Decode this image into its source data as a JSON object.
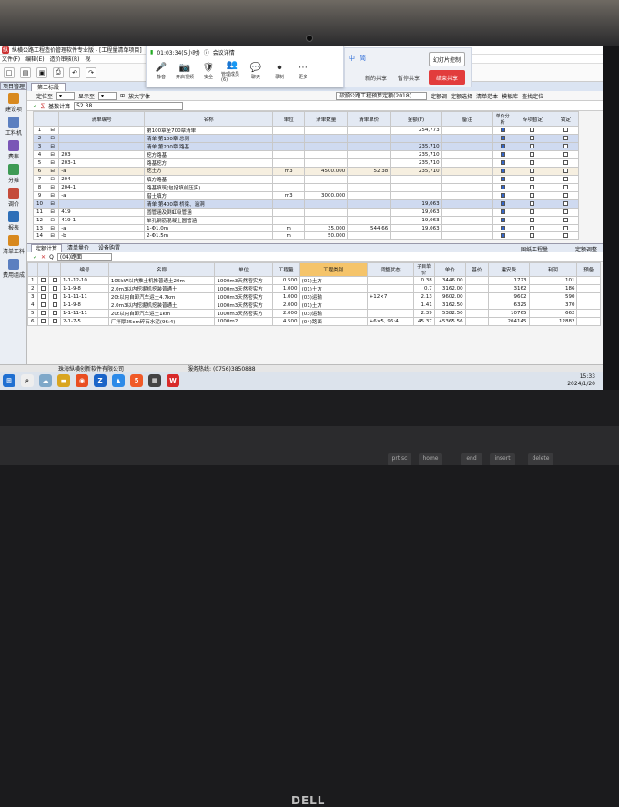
{
  "window": {
    "title": "纵横公路工程造价管理软件专业版 - [工程量清单项目]"
  },
  "menu": [
    "文件(F)",
    "编辑(E)",
    "造价审核(R)",
    "视"
  ],
  "meeting": {
    "timer": "01:03:34(5小时)",
    "info": "会议详情",
    "buttons": [
      "静音",
      "开启视频",
      "安全",
      "管理成员(6)",
      "聊天",
      "录制",
      "更多"
    ],
    "glyphs": [
      "🎤",
      "📷",
      "🛡",
      "👥",
      "💬",
      "⏺",
      "⋯"
    ]
  },
  "share_panel": {
    "left_label": "中",
    "lang": "简",
    "button_new": "新的共享",
    "button_pause": "暂停共享",
    "button_whiteboard": "幻灯片控制",
    "button_end": "结束共享"
  },
  "left_nav": {
    "project_tab": "项目管理",
    "items": [
      "建设项",
      "工料机",
      "费率",
      "分摊",
      "调价",
      "报表",
      "清单工料",
      "费用组成"
    ]
  },
  "tabs": {
    "second_tab": "第二标段"
  },
  "toolbar1": {
    "locate": "定位至",
    "display": "显示至",
    "zoom": "放大字体",
    "standard": "部颁公路工程预算定额(2018)",
    "actions": [
      "定额调",
      "定额选择",
      "清单范本",
      "模板库",
      "查找定位"
    ]
  },
  "toolbar2": {
    "base_calc": "基数计算",
    "value": "52.38"
  },
  "table1": {
    "headers": [
      "清单编号",
      "名称",
      "单位",
      "清单数量",
      "清单单价",
      "金额(F)",
      "备注",
      "单价分析",
      "专项暂定",
      "锁定"
    ],
    "rows": [
      {
        "n": "1",
        "code": "",
        "name": "第100章至700章清单",
        "unit": "",
        "qty": "",
        "price": "",
        "amount": "254,773",
        "note": "",
        "a": true,
        "b": false,
        "c": false,
        "style": ""
      },
      {
        "n": "2",
        "code": "",
        "name": "清单 第100章 总则",
        "unit": "",
        "qty": "",
        "price": "",
        "amount": "",
        "note": "",
        "a": true,
        "b": false,
        "c": false,
        "style": "blue"
      },
      {
        "n": "3",
        "code": "",
        "name": "清单 第200章 路基",
        "unit": "",
        "qty": "",
        "price": "",
        "amount": "235,710",
        "note": "",
        "a": true,
        "b": false,
        "c": false,
        "style": "blue"
      },
      {
        "n": "4",
        "code": "203",
        "name": "挖方路基",
        "unit": "",
        "qty": "",
        "price": "",
        "amount": "235,710",
        "note": "",
        "a": true,
        "b": false,
        "c": false,
        "style": ""
      },
      {
        "n": "5",
        "code": "203-1",
        "name": "路基挖方",
        "unit": "",
        "qty": "",
        "price": "",
        "amount": "235,710",
        "note": "",
        "a": true,
        "b": false,
        "c": false,
        "style": ""
      },
      {
        "n": "6",
        "code": "-a",
        "name": "挖土方",
        "unit": "m3",
        "qty": "4500.000",
        "price": "52.38",
        "amount": "235,710",
        "note": "",
        "a": true,
        "b": false,
        "c": false,
        "style": "sel"
      },
      {
        "n": "7",
        "code": "204",
        "name": "填方路基",
        "unit": "",
        "qty": "",
        "price": "",
        "amount": "",
        "note": "",
        "a": true,
        "b": false,
        "c": false,
        "style": ""
      },
      {
        "n": "8",
        "code": "204-1",
        "name": "路基填筑(包括填前压实)",
        "unit": "",
        "qty": "",
        "price": "",
        "amount": "",
        "note": "",
        "a": true,
        "b": false,
        "c": false,
        "style": ""
      },
      {
        "n": "9",
        "code": "-a",
        "name": "借土填方",
        "unit": "m3",
        "qty": "3000.000",
        "price": "",
        "amount": "",
        "note": "",
        "a": true,
        "b": false,
        "c": false,
        "style": ""
      },
      {
        "n": "10",
        "code": "",
        "name": "清单 第400章 桥梁、涵洞",
        "unit": "",
        "qty": "",
        "price": "",
        "amount": "19,063",
        "note": "",
        "a": true,
        "b": false,
        "c": false,
        "style": "blue"
      },
      {
        "n": "11",
        "code": "419",
        "name": "圆管涵及倒虹吸管涵",
        "unit": "",
        "qty": "",
        "price": "",
        "amount": "19,063",
        "note": "",
        "a": true,
        "b": false,
        "c": false,
        "style": ""
      },
      {
        "n": "12",
        "code": "419-1",
        "name": "单孔钢筋混凝土圆管涵",
        "unit": "",
        "qty": "",
        "price": "",
        "amount": "19,063",
        "note": "",
        "a": true,
        "b": false,
        "c": false,
        "style": ""
      },
      {
        "n": "13",
        "code": "-a",
        "name": "1-Φ1.0m",
        "unit": "m",
        "qty": "35.000",
        "price": "544.66",
        "amount": "19,063",
        "note": "",
        "a": true,
        "b": false,
        "c": false,
        "style": ""
      },
      {
        "n": "14",
        "code": "-b",
        "name": "2-Φ1.5m",
        "unit": "m",
        "qty": "50.000",
        "price": "",
        "amount": "",
        "note": "",
        "a": true,
        "b": false,
        "c": false,
        "style": ""
      }
    ]
  },
  "bottom": {
    "tabs": [
      "定额计算",
      "清单量价",
      "设备购置"
    ],
    "right_actions": [
      "图纸工程量",
      "定额调整"
    ],
    "filter": "(04)路面",
    "headers": [
      "编号",
      "名称",
      "单位",
      "工程量",
      "工程类别",
      "调整状态",
      "子目单价",
      "单价",
      "基价",
      "建安费",
      "利润",
      "预备"
    ],
    "rows": [
      {
        "n": "1",
        "code": "1-1-12-10",
        "name": "105kW以内推土机推普通土20m",
        "unit": "1000m3天然密实方",
        "qty": "0.500",
        "cat": "(01)土方",
        "adj": "",
        "sub": "0.38",
        "price": "3446.00",
        "base": "",
        "jaf": "1723",
        "profit": "101"
      },
      {
        "n": "2",
        "code": "1-1-9-8",
        "name": "2.0m3以内挖掘机挖装普通土",
        "unit": "1000m3天然密实方",
        "qty": "1.000",
        "cat": "(01)土方",
        "adj": "",
        "sub": "0.7",
        "price": "3162.00",
        "base": "",
        "jaf": "3162",
        "profit": "186"
      },
      {
        "n": "3",
        "code": "1-1-11-11",
        "name": "20t以内自卸汽车运土4.7km",
        "unit": "1000m3天然密实方",
        "qty": "1.000",
        "cat": "(03)运输",
        "adj": "+12×7",
        "sub": "2.13",
        "price": "9602.00",
        "base": "",
        "jaf": "9602",
        "profit": "590"
      },
      {
        "n": "4",
        "code": "1-1-9-8",
        "name": "2.0m3以内挖掘机挖装普通土",
        "unit": "1000m3天然密实方",
        "qty": "2.000",
        "cat": "(01)土方",
        "adj": "",
        "sub": "1.41",
        "price": "3162.50",
        "base": "",
        "jaf": "6325",
        "profit": "370"
      },
      {
        "n": "5",
        "code": "1-1-11-11",
        "name": "20t以内自卸汽车运土1km",
        "unit": "1000m3天然密实方",
        "qty": "2.000",
        "cat": "(03)运输",
        "adj": "",
        "sub": "2.39",
        "price": "5382.50",
        "base": "",
        "jaf": "10765",
        "profit": "662"
      },
      {
        "n": "6",
        "code": "2-1-7-5",
        "name": "厂拌厚25cm碎石水泥(96:4)",
        "unit": "1000m2",
        "qty": "4.500",
        "cat": "(04)路面",
        "adj": "+6×5, 96:4",
        "sub": "45.37",
        "price": "45365.56",
        "base": "",
        "jaf": "204145",
        "profit": "12882"
      }
    ]
  },
  "status": {
    "company": "珠海纵横创新软件有限公司",
    "hotline": "服务热线: (0756)3850888"
  },
  "taskbar": {
    "time": "15:33",
    "date": "2024/1/20"
  },
  "laptop": {
    "brand": "DELL",
    "keys": [
      "prt sc",
      "home",
      "end",
      "insert",
      "delete"
    ]
  }
}
